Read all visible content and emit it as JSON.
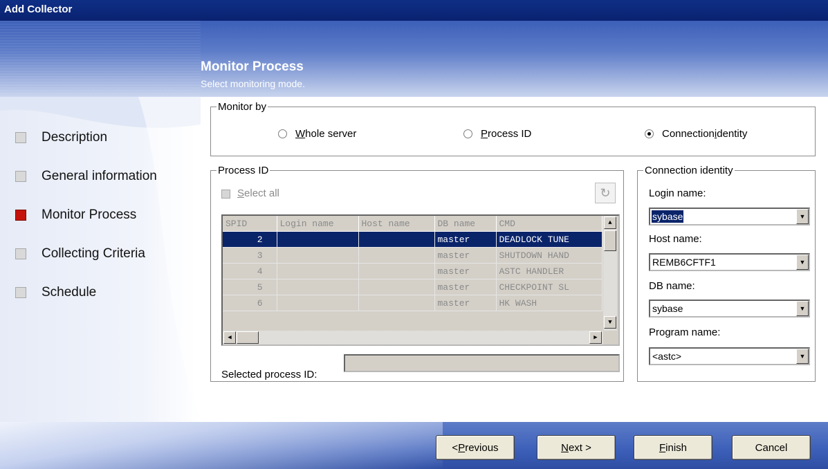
{
  "window": {
    "title": "Add Collector"
  },
  "header": {
    "title": "Monitor Process",
    "subtitle": "Select monitoring mode."
  },
  "sidebar": {
    "items": [
      {
        "label": "Description",
        "active": false
      },
      {
        "label": "General information",
        "active": false
      },
      {
        "label": "Monitor Process",
        "active": true
      },
      {
        "label": "Collecting Criteria",
        "active": false
      },
      {
        "label": "Schedule",
        "active": false
      }
    ]
  },
  "monitor_by": {
    "legend": "Monitor by",
    "options": [
      {
        "pre": "",
        "key": "W",
        "post": "hole server",
        "checked": false
      },
      {
        "pre": "",
        "key": "P",
        "post": "rocess ID",
        "checked": false
      },
      {
        "pre": "Connection ",
        "key": "i",
        "post": "dentity",
        "checked": true
      }
    ]
  },
  "process_id": {
    "legend": "Process ID",
    "select_all_key": "S",
    "select_all_rest": "elect all",
    "refresh_icon": "refresh-icon",
    "columns": [
      "SPID",
      "Login name",
      "Host name",
      "DB name",
      "CMD"
    ],
    "rows": [
      {
        "spid": "2",
        "login": "",
        "host": "",
        "db": "master",
        "cmd": "DEADLOCK TUNE",
        "selected": true
      },
      {
        "spid": "3",
        "login": "",
        "host": "",
        "db": "master",
        "cmd": "SHUTDOWN HAND",
        "selected": false
      },
      {
        "spid": "4",
        "login": "",
        "host": "",
        "db": "master",
        "cmd": "ASTC HANDLER",
        "selected": false
      },
      {
        "spid": "5",
        "login": "",
        "host": "",
        "db": "master",
        "cmd": "CHECKPOINT SL",
        "selected": false
      },
      {
        "spid": "6",
        "login": "",
        "host": "",
        "db": "master",
        "cmd": "HK WASH",
        "selected": false
      }
    ],
    "selected_label": "Selected process ID:",
    "selected_value": ""
  },
  "connection_identity": {
    "legend": "Connection identity",
    "login_label": "Login name:",
    "login_value": "sybase",
    "host_label": "Host name:",
    "host_value": "REMB6CFTF1",
    "db_label": "DB name:",
    "db_value": "sybase",
    "program_label": "Program name:",
    "program_value": "<astc>"
  },
  "buttons": {
    "previous_pre": "< ",
    "previous_key": "P",
    "previous_post": "revious",
    "next_key": "N",
    "next_post": "ext >",
    "finish_key": "F",
    "finish_post": "inish",
    "cancel": "Cancel"
  }
}
